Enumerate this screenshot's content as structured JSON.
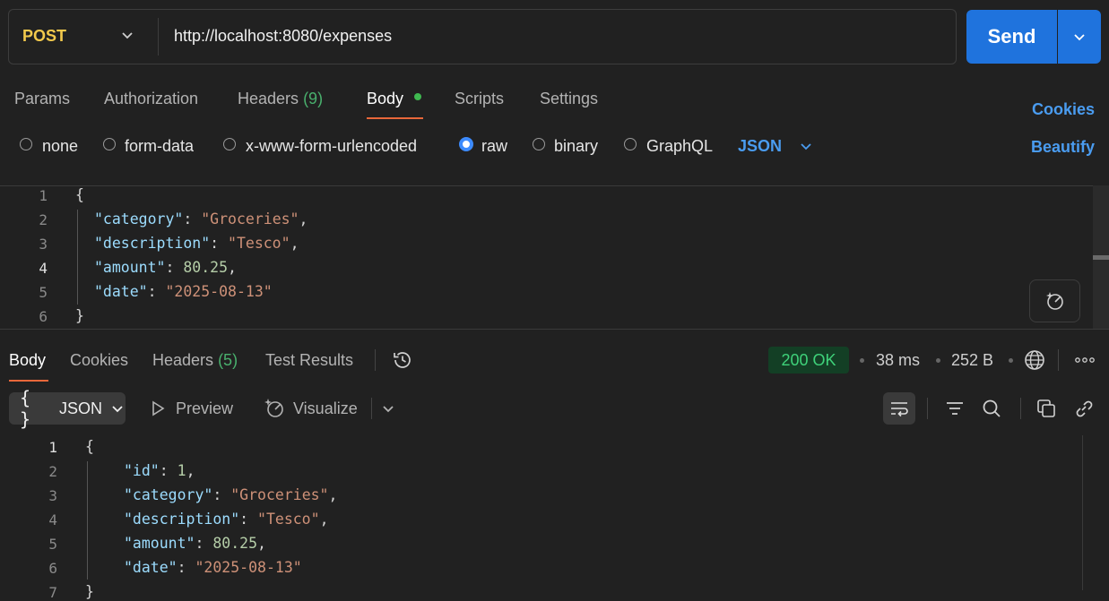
{
  "request": {
    "method": "POST",
    "url": "http://localhost:8080/expenses",
    "send_label": "Send"
  },
  "request_tabs": {
    "params": "Params",
    "authorization": "Authorization",
    "headers_label": "Headers",
    "headers_count": "(9)",
    "body": "Body",
    "scripts": "Scripts",
    "settings": "Settings"
  },
  "links": {
    "cookies": "Cookies",
    "beautify": "Beautify"
  },
  "body_types": {
    "none": "none",
    "form_data": "form-data",
    "urlencoded": "x-www-form-urlencoded",
    "raw": "raw",
    "binary": "binary",
    "graphql": "GraphQL",
    "selected_raw": "raw",
    "format": "JSON"
  },
  "request_body": {
    "line_numbers": [
      "1",
      "2",
      "3",
      "4",
      "5",
      "6"
    ],
    "open": "{",
    "close": "}",
    "category_key": "\"category\"",
    "category_val": "\"Groceries\"",
    "description_key": "\"description\"",
    "description_val": "\"Tesco\"",
    "amount_key": "\"amount\"",
    "amount_val": "80.25",
    "date_key": "\"date\"",
    "date_val": "\"2025-08-13\""
  },
  "response_tabs": {
    "body": "Body",
    "cookies": "Cookies",
    "headers_label": "Headers",
    "headers_count": "(5)",
    "test_results": "Test Results"
  },
  "response_meta": {
    "status": "200 OK",
    "time": "38 ms",
    "size": "252 B"
  },
  "response_toolbar": {
    "format": "JSON",
    "preview": "Preview",
    "visualize": "Visualize"
  },
  "response_body": {
    "line_numbers": [
      "1",
      "2",
      "3",
      "4",
      "5",
      "6",
      "7"
    ],
    "open": "{",
    "close": "}",
    "id_key": "\"id\"",
    "id_val": "1",
    "category_key": "\"category\"",
    "category_val": "\"Groceries\"",
    "description_key": "\"description\"",
    "description_val": "\"Tesco\"",
    "amount_key": "\"amount\"",
    "amount_val": "80.25",
    "date_key": "\"date\"",
    "date_val": "\"2025-08-13\""
  }
}
